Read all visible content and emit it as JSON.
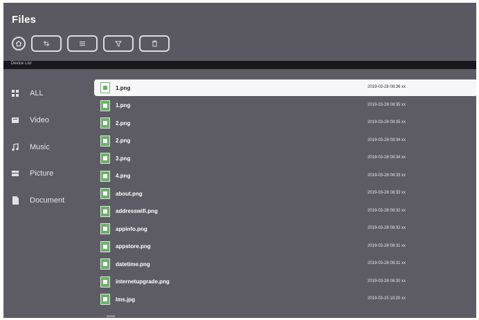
{
  "header": {
    "title": "Files"
  },
  "toolbar": {
    "buttons": [
      {
        "name": "home",
        "icon": "home-icon"
      },
      {
        "name": "sort",
        "icon": "sort-icon"
      },
      {
        "name": "view",
        "icon": "list-view-icon"
      },
      {
        "name": "filter",
        "icon": "filter-icon"
      },
      {
        "name": "delete",
        "icon": "trash-icon"
      }
    ]
  },
  "path": {
    "label": "Device List"
  },
  "sidebar": {
    "items": [
      {
        "label": "ALL",
        "icon": "grid-icon"
      },
      {
        "label": "Video",
        "icon": "video-icon"
      },
      {
        "label": "Music",
        "icon": "music-icon"
      },
      {
        "label": "Picture",
        "icon": "picture-icon"
      },
      {
        "label": "Document",
        "icon": "document-icon"
      }
    ]
  },
  "files": [
    {
      "name": "1.png",
      "date": "2019-03-28 08:36 xx",
      "selected": true
    },
    {
      "name": "1.png",
      "date": "2019-03-28 08:35 xx"
    },
    {
      "name": "2.png",
      "date": "2019-03-28 08:35 xx"
    },
    {
      "name": "2.png",
      "date": "2019-03-28 08:34 xx"
    },
    {
      "name": "3.png",
      "date": "2019-03-28 08:34 xx"
    },
    {
      "name": "4.png",
      "date": "2019-03-28 08:33 xx"
    },
    {
      "name": "about.png",
      "date": "2019-03-28 08:33 xx"
    },
    {
      "name": "addresswifi.png",
      "date": "2019-03-28 08:32 xx"
    },
    {
      "name": "appinfo.png",
      "date": "2019-03-28 08:32 xx"
    },
    {
      "name": "appstore.png",
      "date": "2019-03-28 08:31 xx"
    },
    {
      "name": "datetime.png",
      "date": "2019-03-28 08:31 xx"
    },
    {
      "name": "internetupgrade.png",
      "date": "2019-03-28 08:30 xx"
    },
    {
      "name": "lms.jpg",
      "date": "2019-03-15 10:20 xx"
    }
  ],
  "colors": {
    "background": "#5d5c65",
    "pathbar": "#19181d",
    "selected_row": "#f7f7f9",
    "file_icon": "#6cae6a"
  }
}
